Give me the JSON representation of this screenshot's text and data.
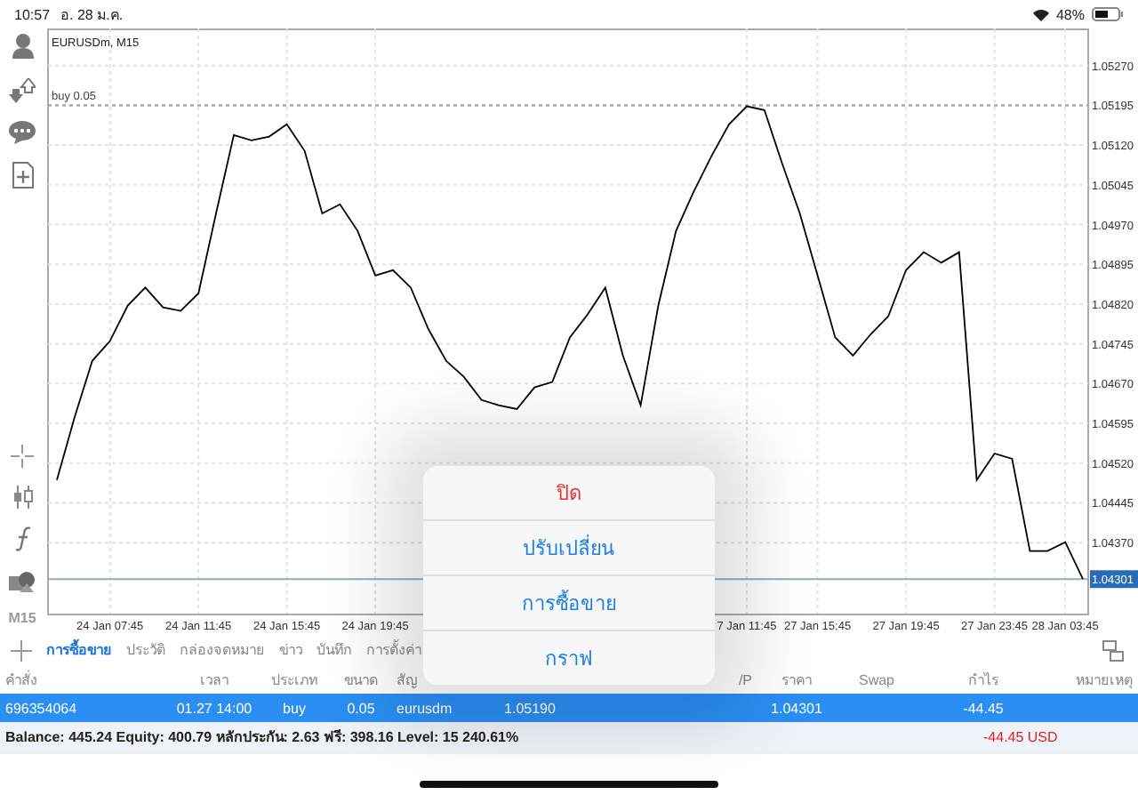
{
  "status_bar": {
    "time": "10:57",
    "date": "อ. 28 ม.ค.",
    "battery": "48%"
  },
  "toolbar": {
    "timeframe": "M15"
  },
  "chart": {
    "chart_data": {
      "type": "line",
      "title": "EURUSDm, M15",
      "grid": true,
      "categories": [
        null,
        null,
        null,
        "24 Jan 07:45",
        null,
        null,
        null,
        null,
        "24 Jan 11:45",
        null,
        null,
        null,
        null,
        "24 Jan 15:45",
        null,
        null,
        null,
        null,
        "24 Jan 19:45",
        null,
        null,
        null,
        null,
        null,
        null,
        null,
        null,
        null,
        null,
        null,
        null,
        null,
        null,
        null,
        null,
        null,
        null,
        null,
        null,
        "7 Jan 11:45",
        null,
        null,
        null,
        "27 Jan 15:45",
        null,
        null,
        null,
        null,
        "27 Jan 19:45",
        null,
        null,
        null,
        null,
        "27 Jan 23:45",
        null,
        null,
        null,
        "28 Jan 03:45",
        null
      ],
      "series": [
        {
          "color": "#000000",
          "values": [
            1.04488,
            1.04606,
            1.04713,
            1.0475,
            1.04817,
            1.04851,
            1.04814,
            1.04807,
            1.0484,
            1.04991,
            1.05139,
            1.05129,
            1.05136,
            1.05159,
            1.05109,
            1.04991,
            1.05008,
            1.04958,
            1.04874,
            1.04884,
            1.04851,
            1.04773,
            1.04713,
            1.04683,
            1.04639,
            1.04629,
            1.04622,
            1.04663,
            1.04673,
            1.04757,
            1.048,
            1.04851,
            1.04723,
            1.04629,
            1.04817,
            1.04958,
            1.05032,
            1.05099,
            1.05159,
            1.05193,
            1.05186,
            1.05085,
            1.04991,
            1.04874,
            1.04757,
            1.04723,
            1.04763,
            1.04797,
            1.04884,
            1.04918,
            1.04898,
            1.04918,
            1.04488,
            1.04538,
            1.04528,
            1.04354,
            1.04354,
            1.04371,
            1.04301
          ]
        }
      ],
      "ylim": [
        1.04236,
        1.0534
      ],
      "yticks": [
        {
          "value": 1.0527,
          "label": "1.05270"
        },
        {
          "value": 1.05195,
          "label": "1.05195"
        },
        {
          "value": 1.0512,
          "label": "1.05120"
        },
        {
          "value": 1.05045,
          "label": "1.05045"
        },
        {
          "value": 1.0497,
          "label": "1.04970"
        },
        {
          "value": 1.04895,
          "label": "1.04895"
        },
        {
          "value": 1.0482,
          "label": "1.04820"
        },
        {
          "value": 1.04745,
          "label": "1.04745"
        },
        {
          "value": 1.0467,
          "label": "1.04670"
        },
        {
          "value": 1.04595,
          "label": "1.04595"
        },
        {
          "value": 1.0452,
          "label": "1.04520"
        },
        {
          "value": 1.04445,
          "label": "1.04445"
        },
        {
          "value": 1.0437,
          "label": "1.04370"
        }
      ],
      "ref_lines": [
        {
          "axis": "y",
          "value": 1.05195,
          "label": "buy 0.05"
        },
        {
          "axis": "y",
          "value": 1.04301,
          "label": "1.04301"
        }
      ]
    }
  },
  "tabs": [
    {
      "label": "การซื้อขาย",
      "selected": true
    },
    {
      "label": "ประวัติ",
      "selected": false
    },
    {
      "label": "กล่องจดหมาย",
      "selected": false
    },
    {
      "label": "ข่าว",
      "selected": false
    },
    {
      "label": "บันทึก",
      "selected": false
    },
    {
      "label": "การตั้งค่า",
      "selected": false
    }
  ],
  "table": {
    "columns": [
      "คำสั่ง",
      "เวลา",
      "ประเภท",
      "ขนาด",
      "สัญ",
      "",
      "",
      "/P",
      "ราคา",
      "Swap",
      "กำไร",
      "หมายเหตุ"
    ],
    "rows": [
      {
        "selected": true,
        "cells": [
          "696354064",
          "01.27 14:00",
          "buy",
          "0.05",
          "eurusdm",
          "1.05190",
          "",
          "",
          "1.04301",
          "",
          "-44.45",
          ""
        ]
      }
    ]
  },
  "summary": {
    "text": "Balance: 445.24 Equity: 400.79 หลักประกัน: 2.63 ฟรี: 398.16 Level: 15 240.61%",
    "profit": "-44.45  USD"
  },
  "menu": {
    "items": [
      {
        "label": "ปิด",
        "kind": "destructive"
      },
      {
        "label": "ปรับเปลี่ยน",
        "kind": "default"
      },
      {
        "label": "การซื้อขาย",
        "kind": "default"
      },
      {
        "label": "กราฟ",
        "kind": "default"
      }
    ]
  }
}
